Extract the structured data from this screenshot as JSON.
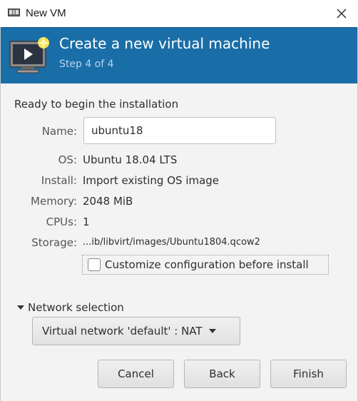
{
  "window": {
    "title": "New VM",
    "close_icon": "close-icon"
  },
  "header": {
    "title": "Create a new virtual machine",
    "step": "Step 4 of 4",
    "background": "#1a6ea8",
    "icon": "vm-screen-icon"
  },
  "summary": {
    "heading": "Ready to begin the installation",
    "name_label": "Name:",
    "name_value": "ubuntu18",
    "os_label": "OS:",
    "os_value": "Ubuntu 18.04 LTS",
    "install_label": "Install:",
    "install_value": "Import existing OS image",
    "memory_label": "Memory:",
    "memory_value": "2048 MiB",
    "cpus_label": "CPUs:",
    "cpus_value": "1",
    "storage_label": "Storage:",
    "storage_value": "...ib/libvirt/images/Ubuntu1804.qcow2",
    "customize_label": "Customize configuration before install",
    "customize_checked": false
  },
  "network": {
    "expander_label": "Network selection",
    "selected": "Virtual network 'default' : NAT"
  },
  "buttons": {
    "cancel": "Cancel",
    "back": "Back",
    "finish": "Finish"
  }
}
